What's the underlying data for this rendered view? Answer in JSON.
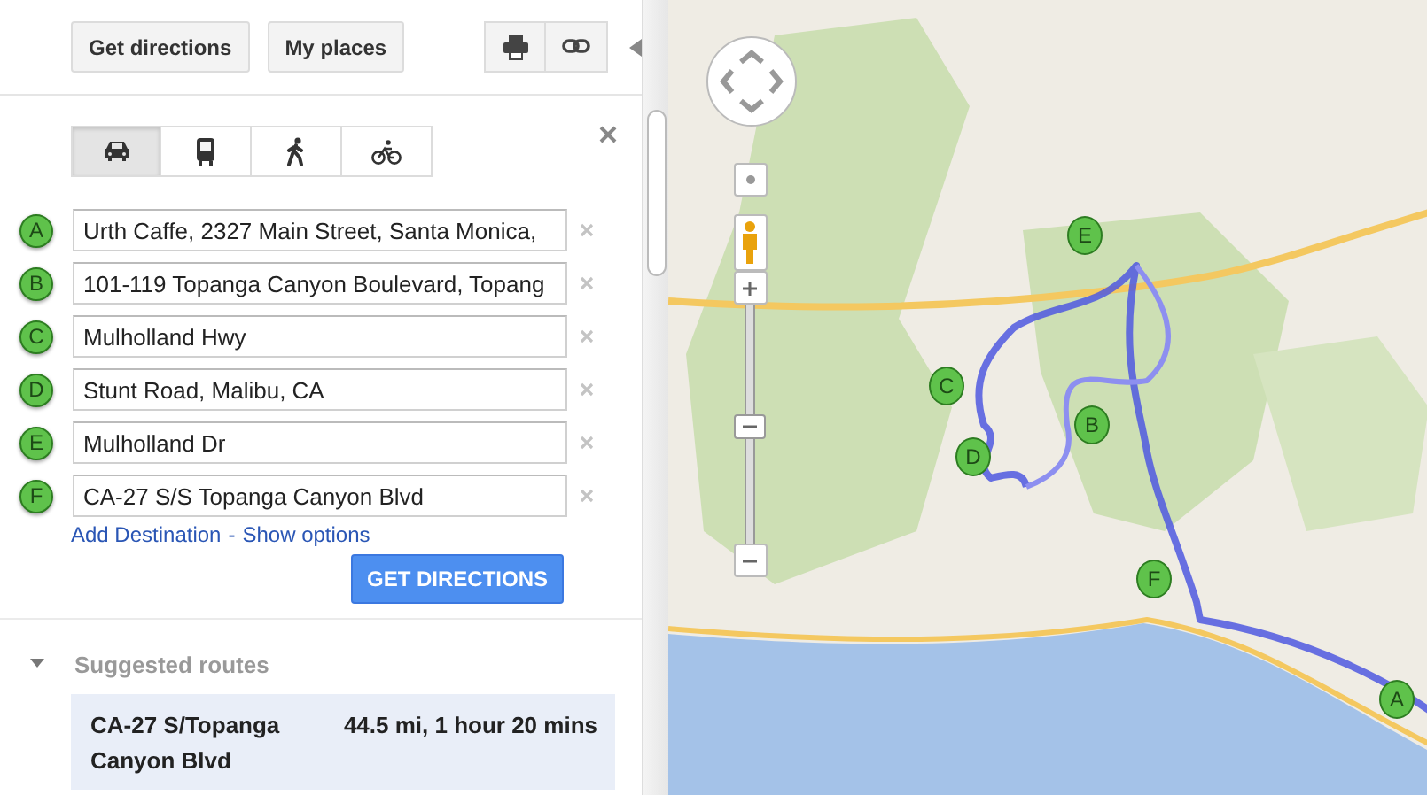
{
  "toolbar": {
    "buttons": [
      {
        "label": "Get directions"
      },
      {
        "label": "My places"
      }
    ],
    "icon_buttons": [
      {
        "kind": "print"
      },
      {
        "kind": "link"
      }
    ]
  },
  "modes": [
    {
      "kind": "car",
      "selected": true
    },
    {
      "kind": "transit",
      "selected": false
    },
    {
      "kind": "walk",
      "selected": false
    },
    {
      "kind": "bike",
      "selected": false
    }
  ],
  "waypoints": [
    {
      "marker": "A",
      "value": "Urth Caffe, 2327 Main Street, Santa Monica,"
    },
    {
      "marker": "B",
      "value": "101-119 Topanga Canyon Boulevard, Topang"
    },
    {
      "marker": "C",
      "value": "Mulholland Hwy"
    },
    {
      "marker": "D",
      "value": "Stunt Road, Malibu, CA"
    },
    {
      "marker": "E",
      "value": "Mulholland Dr"
    },
    {
      "marker": "F",
      "value": "CA-27 S/S Topanga Canyon Blvd"
    }
  ],
  "links": [
    "Add Destination",
    "Show options"
  ],
  "link_separator": "-",
  "submit": "GET DIRECTIONS",
  "suggested": {
    "title": "Suggested routes",
    "expanded": true,
    "routes": [
      {
        "name": "CA-27 S/Topanga Canyon Blvd",
        "summary": "44.5 mi, 1 hour 20 mins",
        "selected": true
      }
    ]
  },
  "map": {
    "markers": [
      {
        "label": "A"
      },
      {
        "label": "B"
      },
      {
        "label": "C"
      },
      {
        "label": "D"
      },
      {
        "label": "E"
      },
      {
        "label": "F"
      }
    ],
    "zoom": {
      "level": 0.5
    }
  }
}
